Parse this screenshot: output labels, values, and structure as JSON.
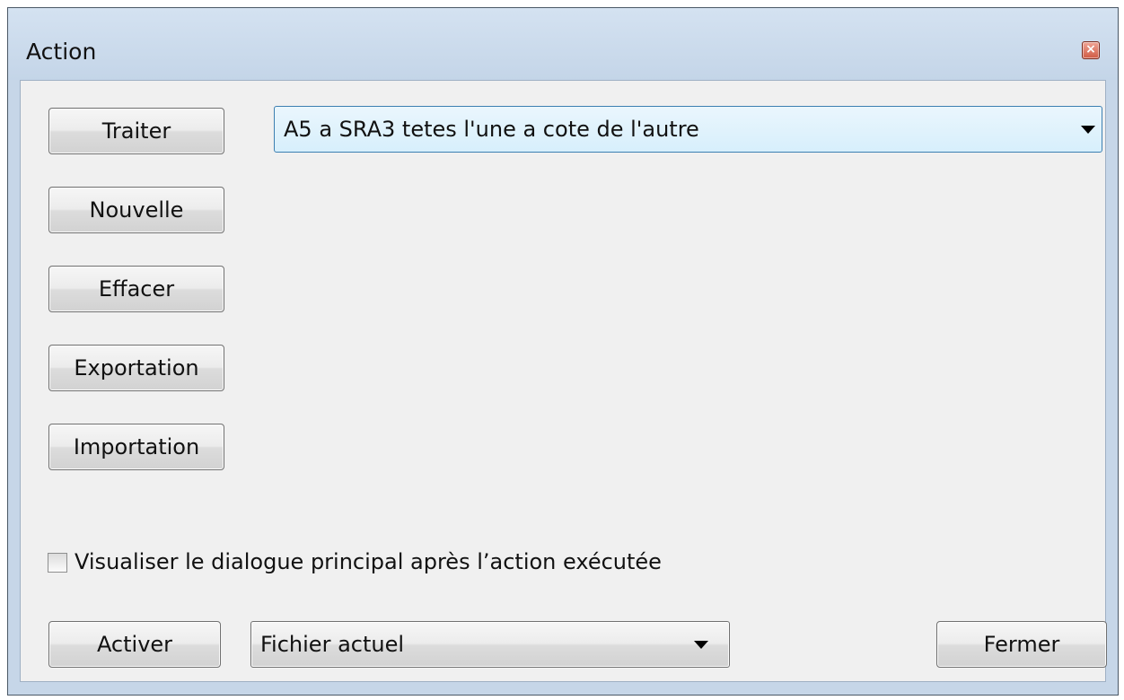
{
  "window": {
    "title": "Action",
    "close_icon": "close-icon"
  },
  "actions": {
    "traiter": "Traiter",
    "nouvelle": "Nouvelle",
    "effacer": "Effacer",
    "exportation": "Exportation",
    "importation": "Importation"
  },
  "preset_select": {
    "value": "A5 a SRA3 tetes l'une a cote de l'autre"
  },
  "option": {
    "checked": false,
    "label": "Visualiser le dialogue principal après l’action exécutée"
  },
  "footer": {
    "activate_label": "Activer",
    "target_select": {
      "value": "Fichier actuel"
    },
    "close_label": "Fermer"
  }
}
